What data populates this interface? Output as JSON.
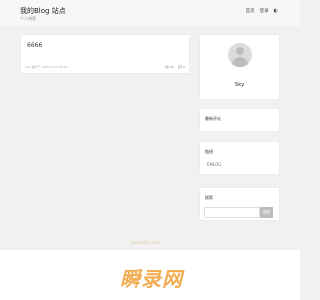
{
  "header": {
    "title": "我的Blog 站点",
    "subtitle": "个人博客",
    "nav": [
      {
        "label": "首页"
      },
      {
        "label": "登录"
      }
    ],
    "theme_icon": "theme-toggle-icon"
  },
  "post": {
    "title": "6666",
    "meta": "Sky 发布于: 2023-2-14 22:32",
    "views": "80",
    "comments": "0"
  },
  "profile": {
    "name": "Sky"
  },
  "widgets": {
    "comments_title": "最新评论",
    "links_title": "链接",
    "link_item": "EMLOG",
    "search_title": "搜索",
    "search_button": "搜索"
  },
  "watermark": {
    "text": "瞬录网",
    "faint_text": "www.sjlsz.com"
  }
}
